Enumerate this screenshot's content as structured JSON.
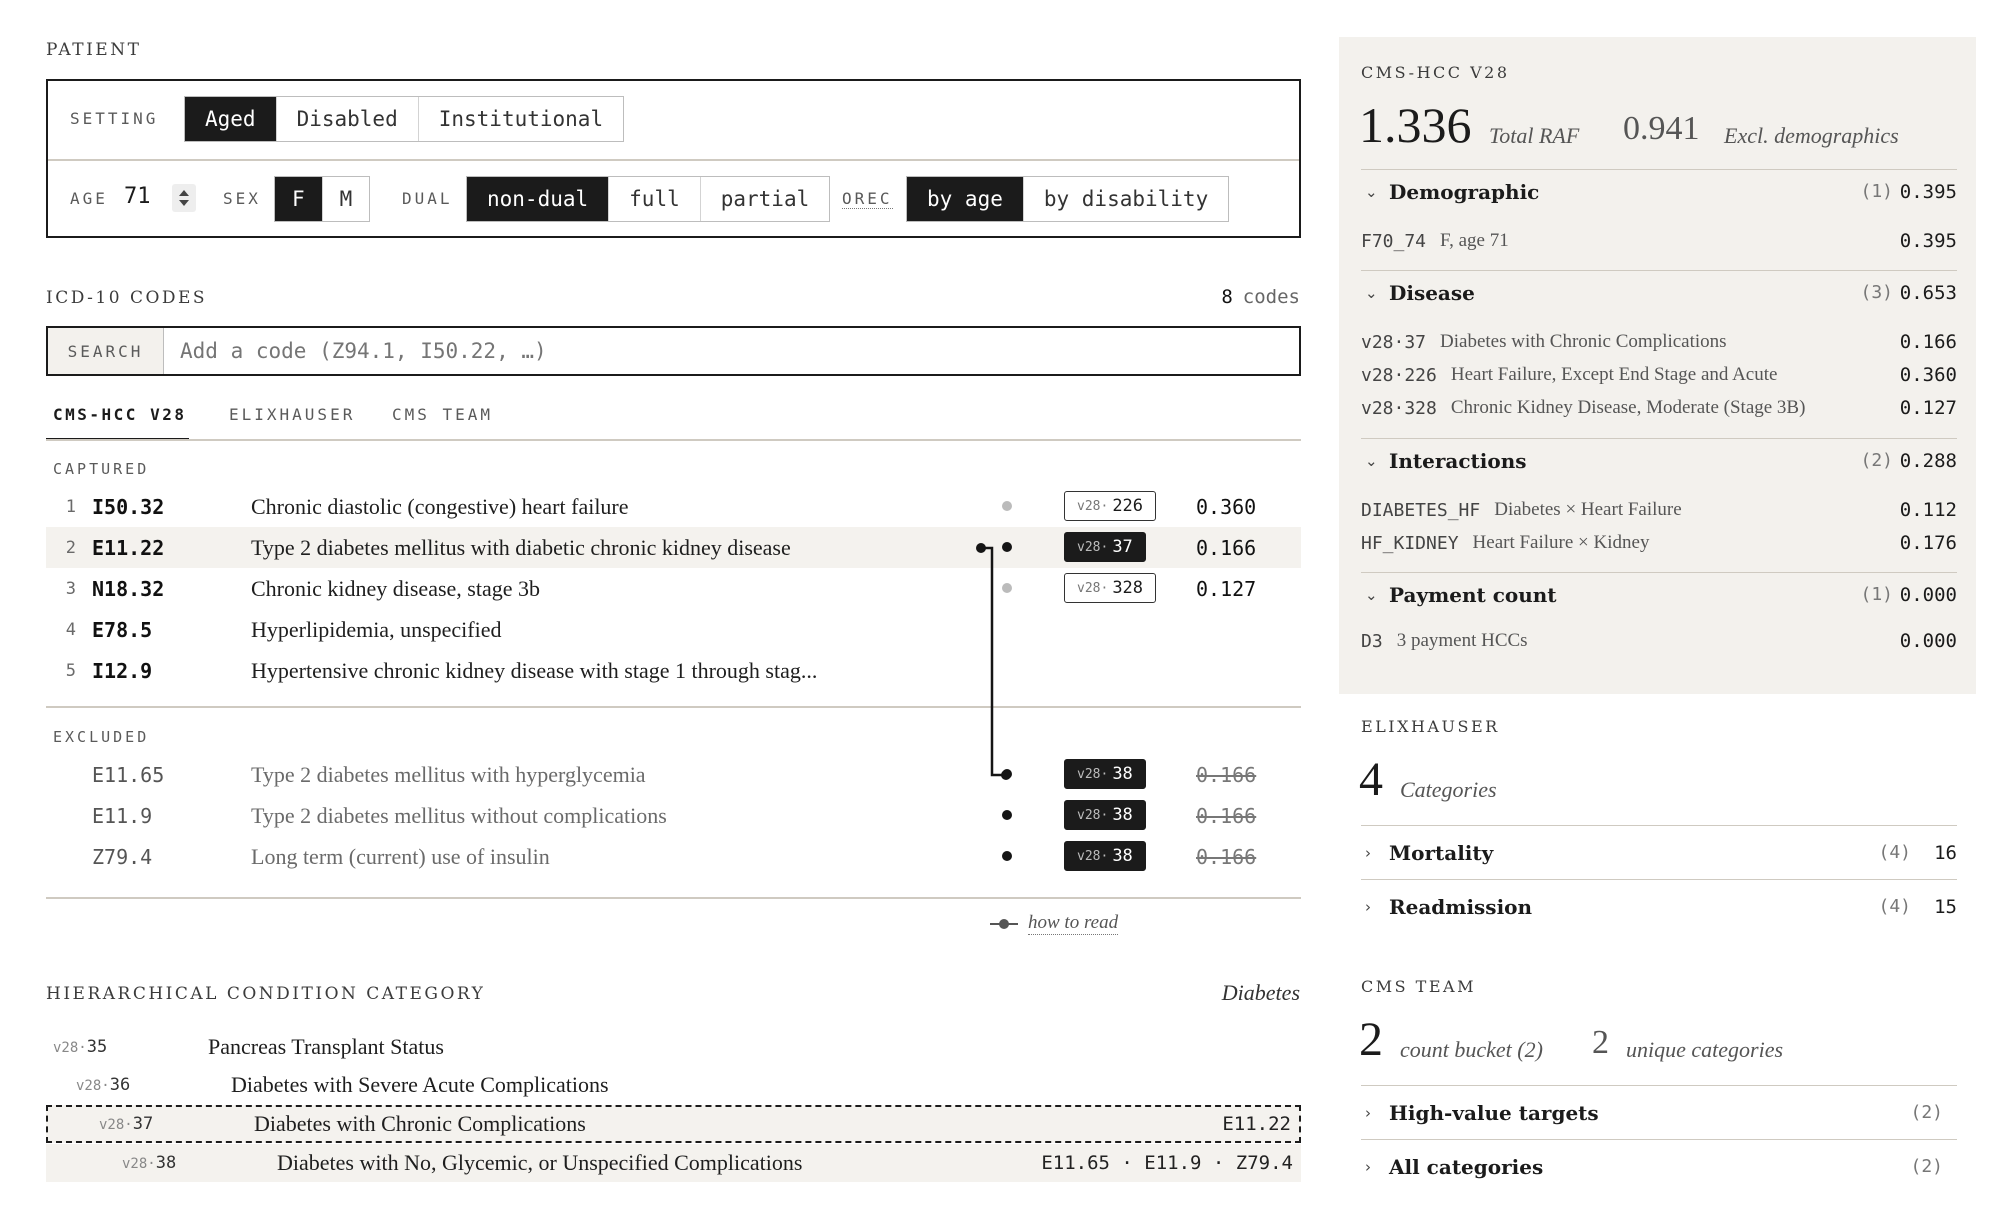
{
  "patient": {
    "section_label": "PATIENT",
    "setting_label": "SETTING",
    "setting_options": [
      "Aged",
      "Disabled",
      "Institutional"
    ],
    "setting_selected": "Aged",
    "age_label": "AGE",
    "age_value": "71",
    "sex_label": "SEX",
    "sex_options": [
      "F",
      "M"
    ],
    "sex_selected": "F",
    "dual_label": "DUAL",
    "dual_options": [
      "non-dual",
      "full",
      "partial"
    ],
    "dual_selected": "non-dual",
    "orec_label": "OREC",
    "orec_options": [
      "by age",
      "by disability"
    ],
    "orec_selected": "by age"
  },
  "icd": {
    "section_label": "ICD-10 CODES",
    "count_num": "8",
    "count_unit": "codes",
    "search_label": "SEARCH",
    "search_placeholder": "Add a code (Z94.1, I50.22, …)",
    "tabs": [
      "CMS-HCC V28",
      "ELIXHAUSER",
      "CMS TEAM"
    ],
    "active_tab": "CMS-HCC V28",
    "captured_label": "CAPTURED",
    "captured": [
      {
        "num": "1",
        "code": "I50.32",
        "desc": "Chronic diastolic (congestive) heart failure",
        "hcc_prefix": "v28·",
        "hcc_num": "226",
        "value": "0.360"
      },
      {
        "num": "2",
        "code": "E11.22",
        "desc": "Type 2 diabetes mellitus with diabetic chronic kidney disease",
        "hcc_prefix": "v28·",
        "hcc_num": "37",
        "value": "0.166"
      },
      {
        "num": "3",
        "code": "N18.32",
        "desc": "Chronic kidney disease, stage 3b",
        "hcc_prefix": "v28·",
        "hcc_num": "328",
        "value": "0.127"
      },
      {
        "num": "4",
        "code": "E78.5",
        "desc": "Hyperlipidemia, unspecified"
      },
      {
        "num": "5",
        "code": "I12.9",
        "desc": "Hypertensive chronic kidney disease with stage 1 through stag..."
      }
    ],
    "excluded_label": "EXCLUDED",
    "excluded": [
      {
        "code": "E11.65",
        "desc": "Type 2 diabetes mellitus with hyperglycemia",
        "hcc_prefix": "v28·",
        "hcc_num": "38",
        "value": "0.166"
      },
      {
        "code": "E11.9",
        "desc": "Type 2 diabetes mellitus without complications",
        "hcc_prefix": "v28·",
        "hcc_num": "38",
        "value": "0.166"
      },
      {
        "code": "Z79.4",
        "desc": "Long term (current) use of insulin",
        "hcc_prefix": "v28·",
        "hcc_num": "38",
        "value": "0.166"
      }
    ],
    "how_to_read": "how to read"
  },
  "hierarchy": {
    "section_label": "HIERARCHICAL CONDITION CATEGORY",
    "group": "Diabetes",
    "rows": [
      {
        "prefix": "v28·",
        "num": "35",
        "desc": "Pancreas Transplant Status",
        "codes": ""
      },
      {
        "prefix": "v28·",
        "num": "36",
        "desc": "Diabetes with Severe Acute Complications",
        "codes": ""
      },
      {
        "prefix": "v28·",
        "num": "37",
        "desc": "Diabetes with Chronic Complications",
        "codes": "E11.22"
      },
      {
        "prefix": "v28·",
        "num": "38",
        "desc": "Diabetes with No, Glycemic, or Unspecified Complications",
        "codes": "E11.65 · E11.9 · Z79.4"
      }
    ]
  },
  "cms_hcc": {
    "section_label": "CMS-HCC V28",
    "total_raf": "1.336",
    "total_raf_label": "Total RAF",
    "excl_demo": "0.941",
    "excl_demo_label": "Excl. demographics",
    "groups": [
      {
        "title": "Demographic",
        "count": "(1)",
        "total": "0.395",
        "items": [
          {
            "code": "F70_74",
            "desc": "F, age 71",
            "value": "0.395"
          }
        ]
      },
      {
        "title": "Disease",
        "count": "(3)",
        "total": "0.653",
        "items": [
          {
            "code": "v28·37",
            "desc": "Diabetes with Chronic Complications",
            "value": "0.166"
          },
          {
            "code": "v28·226",
            "desc": "Heart Failure, Except End Stage and Acute",
            "value": "0.360"
          },
          {
            "code": "v28·328",
            "desc": "Chronic Kidney Disease, Moderate (Stage 3B)",
            "value": "0.127"
          }
        ]
      },
      {
        "title": "Interactions",
        "count": "(2)",
        "total": "0.288",
        "items": [
          {
            "code": "DIABETES_HF",
            "desc": "Diabetes × Heart Failure",
            "value": "0.112"
          },
          {
            "code": "HF_KIDNEY",
            "desc": "Heart Failure × Kidney",
            "value": "0.176"
          }
        ]
      },
      {
        "title": "Payment count",
        "count": "(1)",
        "total": "0.000",
        "items": [
          {
            "code": "D3",
            "desc": "3 payment HCCs",
            "value": "0.000"
          }
        ]
      }
    ]
  },
  "elixhauser": {
    "section_label": "ELIXHAUSER",
    "big_num": "4",
    "big_label": "Categories",
    "groups": [
      {
        "title": "Mortality",
        "count": "(4)",
        "total": "16"
      },
      {
        "title": "Readmission",
        "count": "(4)",
        "total": "15"
      }
    ]
  },
  "cms_team": {
    "section_label": "CMS TEAM",
    "num1": "2",
    "label1": "count bucket (2)",
    "num2": "2",
    "label2": "unique categories",
    "groups": [
      {
        "title": "High-value targets",
        "count": "(2)"
      },
      {
        "title": "All categories",
        "count": "(2)"
      }
    ]
  },
  "icons": [
    "stepper-icon",
    "chevron-down-icon",
    "chevron-right-icon",
    "connector-icon"
  ],
  "colors": {
    "dark": "#1b1b1b",
    "panel": "#f3f1ed",
    "highlight_row": "#f4f2ee"
  }
}
